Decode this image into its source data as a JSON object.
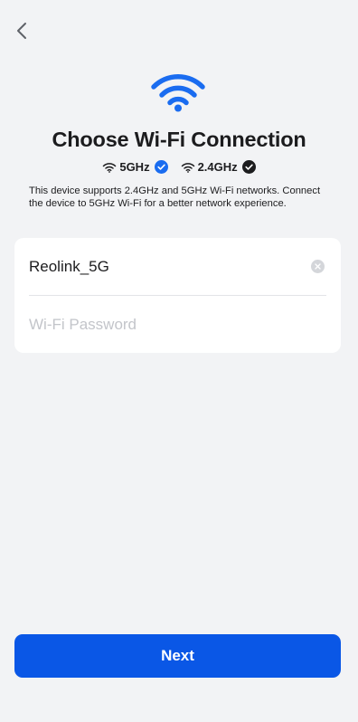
{
  "header": {
    "back_icon": "chevron-left-icon"
  },
  "hero": {
    "icon": "wifi-icon",
    "color": "#1a6cf0"
  },
  "title": "Choose Wi-Fi Connection",
  "bands": [
    {
      "label": "5GHz",
      "icon": "wifi-small-icon",
      "check": "check-circle-icon",
      "check_color": "#1a6cf0"
    },
    {
      "label": "2.4GHz",
      "icon": "wifi-small-icon",
      "check": "check-circle-icon",
      "check_color": "#1c1c1e"
    }
  ],
  "description": "This device supports 2.4GHz and 5GHz Wi-Fi networks. Connect the device to 5GHz Wi-Fi for a better network experience.",
  "form": {
    "ssid_value": "Reolink_5G",
    "clear_icon": "clear-icon",
    "password_value": "",
    "password_placeholder": "Wi-Fi Password"
  },
  "next_label": "Next",
  "colors": {
    "accent": "#0a57e6",
    "background": "#f2f3f5"
  }
}
